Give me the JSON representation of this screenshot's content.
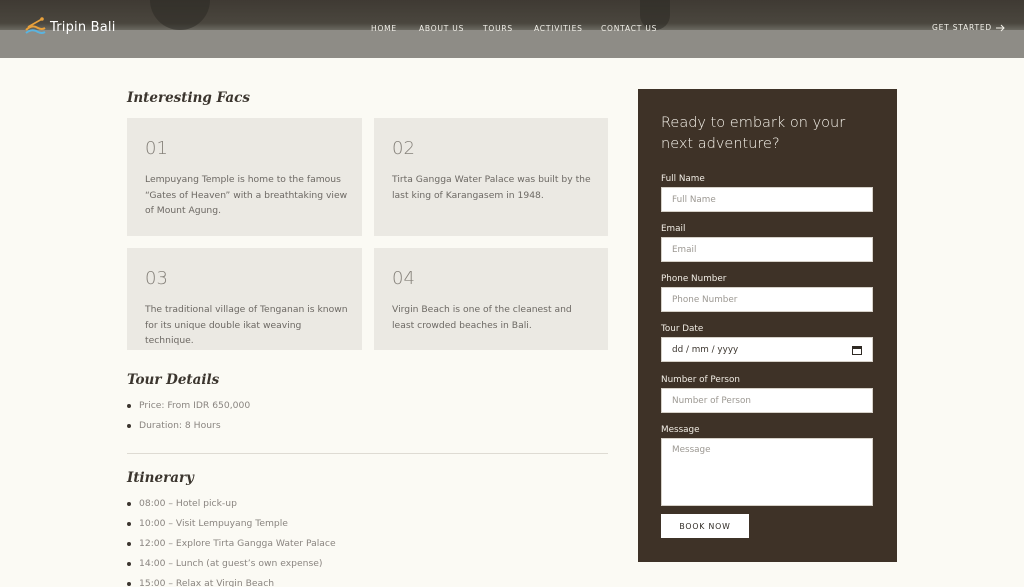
{
  "header": {
    "brand": "Tripin Bali",
    "nav": [
      "HOME",
      "ABOUT US",
      "TOURS",
      "ACTIVITIES",
      "CONTACT US"
    ],
    "cta": "GET STARTED",
    "cta_icon": "arrow-right-icon"
  },
  "facts": {
    "title": "Interesting Facs",
    "items": [
      {
        "num": "01",
        "text": "Lempuyang Temple is home to the famous “Gates of Heaven” with a breathtaking view of Mount Agung."
      },
      {
        "num": "02",
        "text": "Tirta Gangga Water Palace was built by the last king of Karangasem in 1948."
      },
      {
        "num": "03",
        "text": "The traditional village of Tenganan is known for its unique double ikat weaving technique."
      },
      {
        "num": "04",
        "text": "Virgin Beach is one of the cleanest and least crowded beaches in Bali."
      }
    ]
  },
  "tour_details": {
    "title": "Tour Details",
    "items": [
      "Price: From IDR 650,000",
      "Duration: 8 Hours"
    ]
  },
  "itinerary": {
    "title": "Itinerary",
    "items": [
      "08:00 – Hotel pick-up",
      "10:00 – Visit Lempuyang Temple",
      "12:00 – Explore Tirta Gangga Water Palace",
      "14:00 – Lunch (at guest’s own expense)",
      "15:00 – Relax at Virgin Beach"
    ]
  },
  "form": {
    "title": "Ready to embark on your next adventure?",
    "fields": {
      "full_name": {
        "label": "Full Name",
        "placeholder": "Full Name"
      },
      "email": {
        "label": "Email",
        "placeholder": "Email"
      },
      "phone": {
        "label": "Phone Number",
        "placeholder": "Phone Number"
      },
      "tour_date": {
        "label": "Tour Date",
        "value": "dd / mm / yyyy"
      },
      "persons": {
        "label": "Number of Person",
        "placeholder": "Number of Person"
      },
      "message": {
        "label": "Message",
        "placeholder": "Message"
      }
    },
    "submit": "BOOK NOW"
  },
  "colors": {
    "background": "#fbfaf4",
    "card": "#ebe9e3",
    "form_panel": "#3e3227",
    "heading": "#3b352e"
  }
}
